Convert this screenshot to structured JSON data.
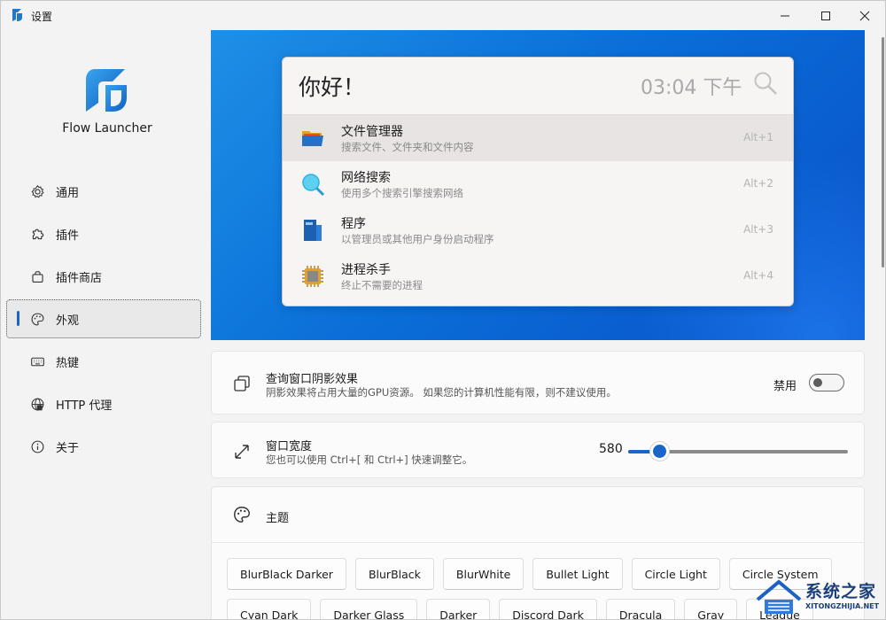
{
  "window": {
    "title": "设置",
    "controls": {
      "minimize": "minimize-icon",
      "maximize": "maximize-icon",
      "close": "close-icon"
    }
  },
  "sidebar": {
    "app_name": "Flow Launcher",
    "items": [
      {
        "label": "通用",
        "icon": "gear-icon"
      },
      {
        "label": "插件",
        "icon": "puzzle-icon"
      },
      {
        "label": "插件商店",
        "icon": "shopping-bag-icon"
      },
      {
        "label": "外观",
        "icon": "palette-icon",
        "active": true
      },
      {
        "label": "热键",
        "icon": "keyboard-icon"
      },
      {
        "label": "HTTP 代理",
        "icon": "globe-icon"
      },
      {
        "label": "关于",
        "icon": "info-icon"
      }
    ]
  },
  "preview": {
    "query": "你好！",
    "clock": "03:04 下午",
    "results": [
      {
        "title": "文件管理器",
        "subtitle": "搜索文件、文件夹和文件内容",
        "hotkey": "Alt+1",
        "icon": "folder-icon"
      },
      {
        "title": "网络搜索",
        "subtitle": "使用多个搜索引擎搜索网络",
        "hotkey": "Alt+2",
        "icon": "magnifier-icon"
      },
      {
        "title": "程序",
        "subtitle": "以管理员或其他用户身份启动程序",
        "hotkey": "Alt+3",
        "icon": "program-icon"
      },
      {
        "title": "进程杀手",
        "subtitle": "终止不需要的进程",
        "hotkey": "Alt+4",
        "icon": "cpu-icon"
      }
    ]
  },
  "shadow_setting": {
    "title": "查询窗口阴影效果",
    "description": "阴影效果将占用大量的GPU资源。 如果您的计算机性能有限，则不建议使用。",
    "toggle_label": "禁用",
    "enabled": false
  },
  "width_setting": {
    "title": "窗口宽度",
    "description": "您也可以使用 Ctrl+[ 和 Ctrl+] 快速调整它。",
    "value": "580"
  },
  "theme_setting": {
    "title": "主题",
    "row1": [
      "BlurBlack Darker",
      "BlurBlack",
      "BlurWhite",
      "Bullet Light",
      "Circle Light",
      "Circle System"
    ],
    "row2": [
      "Cyan Dark",
      "Darker Glass",
      "Darker",
      "Discord Dark",
      "Dracula",
      "Gray",
      "League"
    ]
  },
  "watermark": {
    "text": "系统之家",
    "sub": "XITONGZHIJIA.NET"
  },
  "colors": {
    "accent": "#1b65c9",
    "preview_bg": "#0a6fd8"
  }
}
